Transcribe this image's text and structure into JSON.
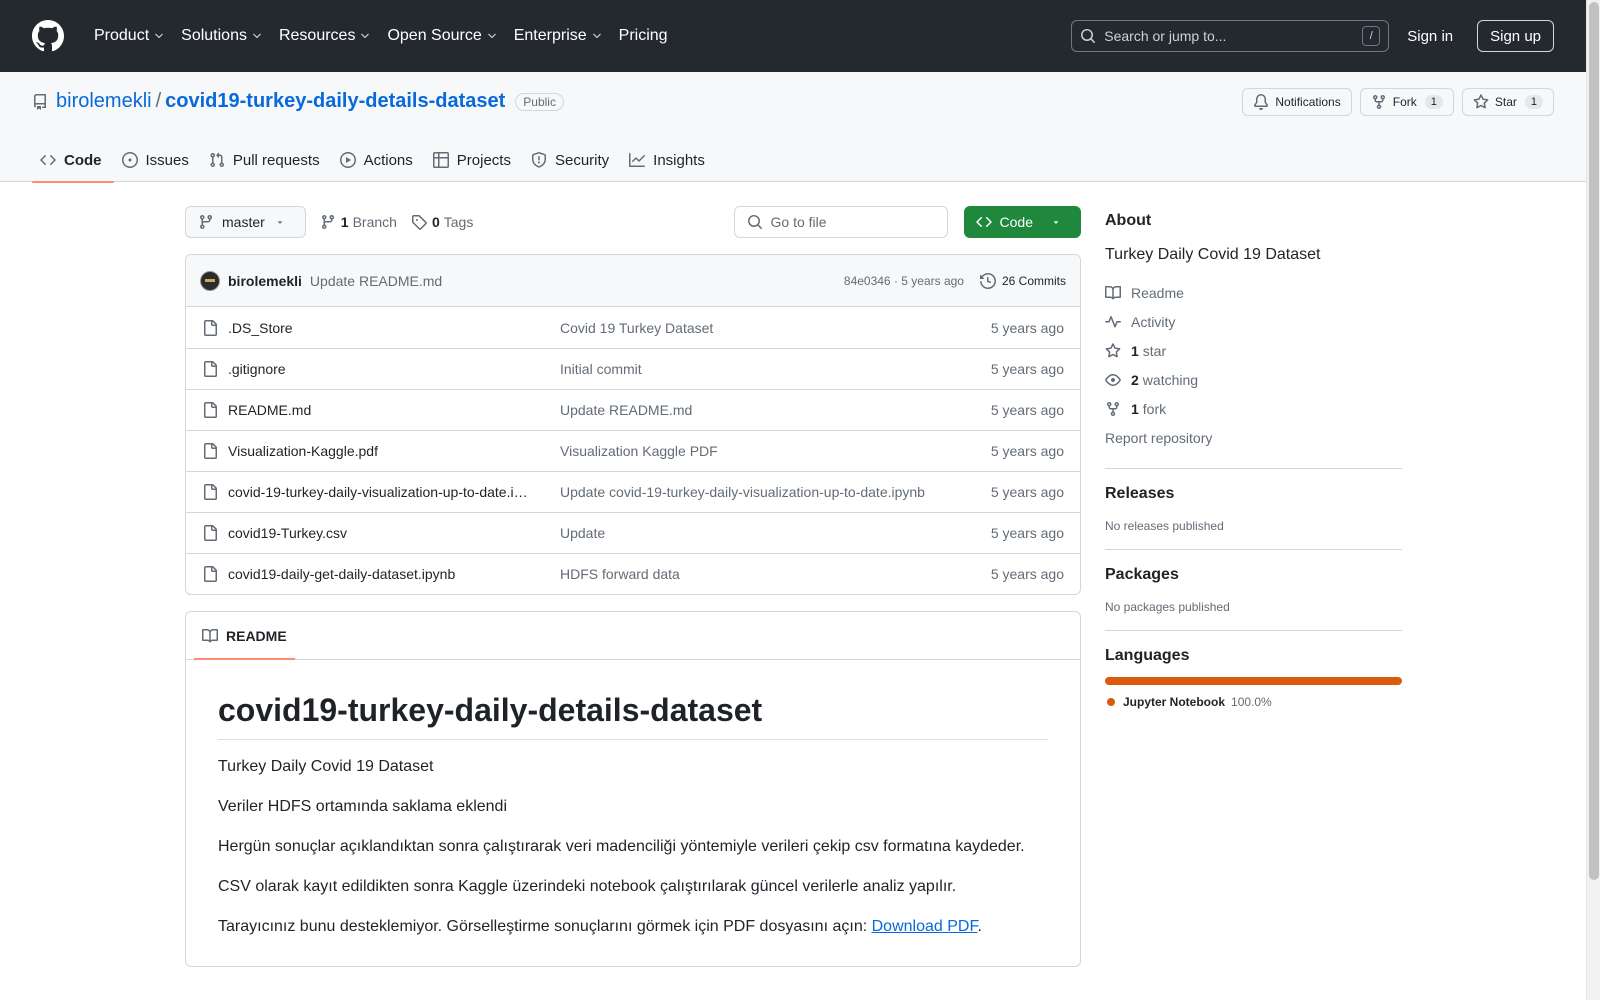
{
  "header": {
    "nav": [
      {
        "label": "Product",
        "has_menu": true
      },
      {
        "label": "Solutions",
        "has_menu": true
      },
      {
        "label": "Resources",
        "has_menu": true
      },
      {
        "label": "Open Source",
        "has_menu": true
      },
      {
        "label": "Enterprise",
        "has_menu": true
      },
      {
        "label": "Pricing",
        "has_menu": false
      }
    ],
    "search_placeholder": "Search or jump to...",
    "search_key": "/",
    "sign_in": "Sign in",
    "sign_up": "Sign up"
  },
  "repo": {
    "owner": "birolemekli",
    "separator": "/",
    "name": "covid19-turkey-daily-details-dataset",
    "visibility": "Public",
    "notifications_label": "Notifications",
    "fork_label": "Fork",
    "fork_count": "1",
    "star_label": "Star",
    "star_count": "1",
    "tabs": [
      {
        "label": "Code",
        "icon": "code-icon",
        "active": true
      },
      {
        "label": "Issues",
        "icon": "issue-icon",
        "active": false
      },
      {
        "label": "Pull requests",
        "icon": "pull-request-icon",
        "active": false
      },
      {
        "label": "Actions",
        "icon": "play-icon",
        "active": false
      },
      {
        "label": "Projects",
        "icon": "table-icon",
        "active": false
      },
      {
        "label": "Security",
        "icon": "shield-icon",
        "active": false
      },
      {
        "label": "Insights",
        "icon": "graph-icon",
        "active": false
      }
    ]
  },
  "file_nav": {
    "branch": "master",
    "branch_count": "1",
    "branch_label": "Branch",
    "tag_count": "0",
    "tag_label": "Tags",
    "goto_placeholder": "Go to file",
    "code_button": "Code"
  },
  "commit": {
    "author": "birolemekli",
    "message": "Update README.md",
    "sha_age": "84e0346 · 5 years ago",
    "commits_label": "26 Commits"
  },
  "files": [
    {
      "name": ".DS_Store",
      "message": "Covid 19 Turkey Dataset",
      "date": "5 years ago"
    },
    {
      "name": ".gitignore",
      "message": "Initial commit",
      "date": "5 years ago"
    },
    {
      "name": "README.md",
      "message": "Update README.md",
      "date": "5 years ago"
    },
    {
      "name": "Visualization-Kaggle.pdf",
      "message": "Visualization Kaggle PDF",
      "date": "5 years ago"
    },
    {
      "name": "covid-19-turkey-daily-visualization-up-to-date.i…",
      "message": "Update covid-19-turkey-daily-visualization-up-to-date.ipynb",
      "date": "5 years ago"
    },
    {
      "name": "covid19-Turkey.csv",
      "message": "Update",
      "date": "5 years ago"
    },
    {
      "name": "covid19-daily-get-daily-dataset.ipynb",
      "message": "HDFS forward data",
      "date": "5 years ago"
    }
  ],
  "readme": {
    "tab_label": "README",
    "title": "covid19-turkey-daily-details-dataset",
    "paragraphs": [
      "Turkey Daily Covid 19 Dataset",
      "Veriler HDFS ortamında saklama eklendi",
      "Hergün sonuçlar açıklandıktan sonra çalıştırarak veri madenciliği yöntemiyle verileri çekip csv formatına kaydeder.",
      "CSV olarak kayıt edildikten sonra Kaggle üzerindeki notebook çalıştırılarak güncel verilerle analiz yapılır."
    ],
    "last_paragraph_text": "Tarayıcınız bunu desteklemiyor. Görselleştirme sonuçlarını görmek için PDF dosyasını açın: ",
    "last_paragraph_link": "Download PDF",
    "last_paragraph_end": "."
  },
  "about": {
    "heading": "About",
    "description": "Turkey Daily Covid 19 Dataset",
    "readme_label": "Readme",
    "activity_label": "Activity",
    "stars_count": "1",
    "stars_label": "star",
    "watching_count": "2",
    "watching_label": "watching",
    "forks_count": "1",
    "forks_label": "fork",
    "report_label": "Report repository"
  },
  "releases": {
    "heading": "Releases",
    "empty": "No releases published"
  },
  "packages": {
    "heading": "Packages",
    "empty": "No packages published"
  },
  "languages": {
    "heading": "Languages",
    "items": [
      {
        "name": "Jupyter Notebook",
        "percent": "100.0%",
        "color": "#DA5B0B"
      }
    ]
  },
  "colors": {
    "header_bg": "#24292f",
    "link": "#0969da",
    "primary_button": "#1f883d",
    "tab_underline": "#fd8c73"
  }
}
